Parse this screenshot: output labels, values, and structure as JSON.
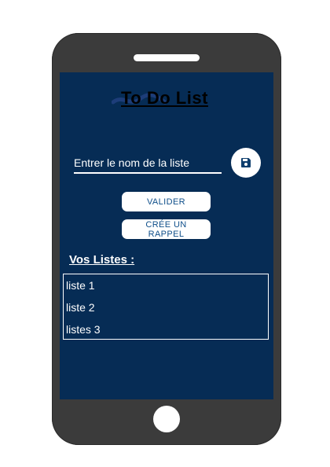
{
  "app": {
    "logo_text": "To Do List"
  },
  "form": {
    "name_placeholder": "Entrer le nom de la liste"
  },
  "buttons": {
    "validate_label": "VALIDER",
    "reminder_label": "CRÉE UN RAPPEL",
    "save_icon": "save-icon"
  },
  "lists": {
    "heading": "Vos Listes :",
    "items": [
      {
        "label": "liste 1"
      },
      {
        "label": "liste 2"
      },
      {
        "label": "listes 3"
      }
    ]
  },
  "colors": {
    "screen_background": "#062c55",
    "phone_body": "#3b3b3b",
    "button_text": "#0f4f8a",
    "logo_swoosh": "#1d3d79"
  }
}
